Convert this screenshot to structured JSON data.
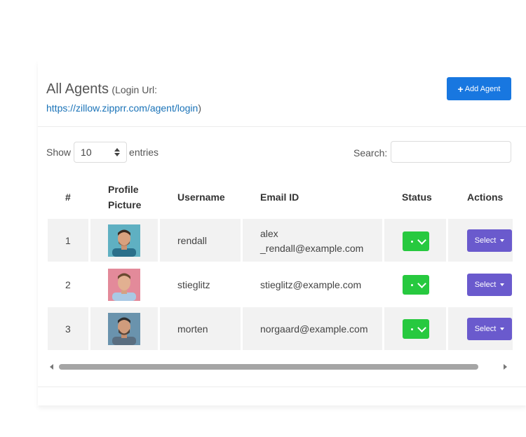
{
  "header": {
    "title": "All Agents",
    "login_label": "(Login Url:",
    "login_url": "https://zillow.zipprr.com/agent/login",
    "login_url_close": ")",
    "add_button": {
      "icon": "plus-icon",
      "label": "Add Agent"
    }
  },
  "controls": {
    "show_label": "Show",
    "entries_value": "10",
    "entries_label": "entries",
    "search_label": "Search:",
    "search_value": ""
  },
  "table": {
    "columns": [
      "#",
      "Profile Picture",
      "Username",
      "Email ID",
      "Status",
      "Actions"
    ],
    "rows": [
      {
        "num": "1",
        "username": "rendall",
        "email_line1": "alex",
        "email_line2": "_rendall@example.com",
        "action": "Select"
      },
      {
        "num": "2",
        "username": "stieglitz",
        "email": "stieglitz@example.com",
        "action": "Select"
      },
      {
        "num": "3",
        "username": "morten",
        "email": "norgaard@example.com",
        "action": "Select"
      }
    ]
  },
  "colors": {
    "add_button": "#1877e0",
    "status": "#27c93f",
    "select_button": "#6a5acd",
    "link": "#1a73b8"
  }
}
